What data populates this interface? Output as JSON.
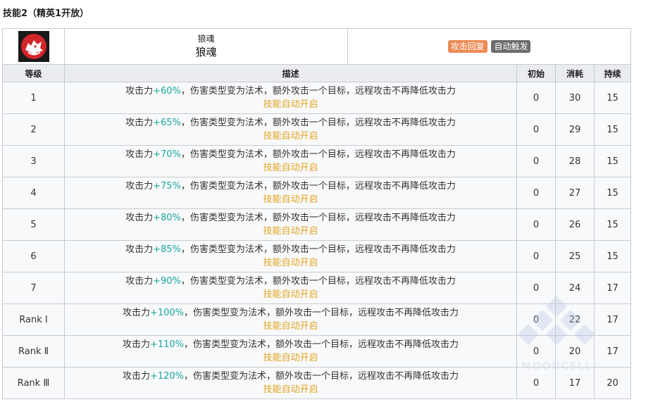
{
  "section": {
    "title": "技能2（精英1开放）"
  },
  "skill": {
    "icon": "wolf-head-icon",
    "name_small": "狼魂",
    "name": "狼魂",
    "tags": [
      {
        "label": "攻击回复",
        "color": "#ec8b56"
      },
      {
        "label": "自动触发",
        "color": "#6c6c6c"
      }
    ]
  },
  "table": {
    "headers": {
      "level": "等级",
      "desc": "描述",
      "initial": "初始",
      "cost": "消耗",
      "duration": "持续"
    },
    "rows": [
      {
        "level": "1",
        "desc_pre": "攻击力",
        "value": "+60%",
        "desc_post": "，伤害类型变为法术，额外攻击一个目标，远程攻击不再降低攻击力",
        "note": "技能自动开启",
        "initial": "0",
        "cost": "30",
        "duration": "15"
      },
      {
        "level": "2",
        "desc_pre": "攻击力",
        "value": "+65%",
        "desc_post": "，伤害类型变为法术，额外攻击一个目标，远程攻击不再降低攻击力",
        "note": "技能自动开启",
        "initial": "0",
        "cost": "29",
        "duration": "15"
      },
      {
        "level": "3",
        "desc_pre": "攻击力",
        "value": "+70%",
        "desc_post": "，伤害类型变为法术，额外攻击一个目标，远程攻击不再降低攻击力",
        "note": "技能自动开启",
        "initial": "0",
        "cost": "28",
        "duration": "15"
      },
      {
        "level": "4",
        "desc_pre": "攻击力",
        "value": "+75%",
        "desc_post": "，伤害类型变为法术，额外攻击一个目标，远程攻击不再降低攻击力",
        "note": "技能自动开启",
        "initial": "0",
        "cost": "27",
        "duration": "15"
      },
      {
        "level": "5",
        "desc_pre": "攻击力",
        "value": "+80%",
        "desc_post": "，伤害类型变为法术，额外攻击一个目标，远程攻击不再降低攻击力",
        "note": "技能自动开启",
        "initial": "0",
        "cost": "26",
        "duration": "15"
      },
      {
        "level": "6",
        "desc_pre": "攻击力",
        "value": "+85%",
        "desc_post": "，伤害类型变为法术，额外攻击一个目标，远程攻击不再降低攻击力",
        "note": "技能自动开启",
        "initial": "0",
        "cost": "25",
        "duration": "15"
      },
      {
        "level": "7",
        "desc_pre": "攻击力",
        "value": "+90%",
        "desc_post": "，伤害类型变为法术，额外攻击一个目标，远程攻击不再降低攻击力",
        "note": "技能自动开启",
        "initial": "0",
        "cost": "24",
        "duration": "17"
      },
      {
        "level": "Rank Ⅰ",
        "desc_pre": "攻击力",
        "value": "+100%",
        "desc_post": "，伤害类型变为法术，额外攻击一个目标，远程攻击不再降低攻击力",
        "note": "技能自动开启",
        "initial": "0",
        "cost": "22",
        "duration": "17"
      },
      {
        "level": "Rank Ⅱ",
        "desc_pre": "攻击力",
        "value": "+110%",
        "desc_post": "，伤害类型变为法术，额外攻击一个目标，远程攻击不再降低攻击力",
        "note": "技能自动开启",
        "initial": "0",
        "cost": "20",
        "duration": "17"
      },
      {
        "level": "Rank Ⅲ",
        "desc_pre": "攻击力",
        "value": "+120%",
        "desc_post": "，伤害类型变为法术，额外攻击一个目标，远程攻击不再降低攻击力",
        "note": "技能自动开启",
        "initial": "0",
        "cost": "17",
        "duration": "20"
      }
    ]
  },
  "watermark": {
    "text": "MOONCELL"
  }
}
